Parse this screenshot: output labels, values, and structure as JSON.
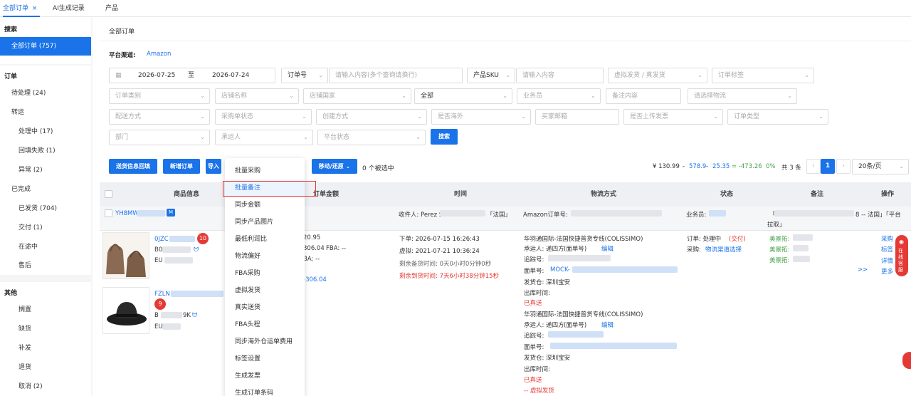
{
  "tabs": [
    {
      "label": "全部订单",
      "close": "×"
    },
    {
      "label": "AI生成记录"
    },
    {
      "label": "产品"
    }
  ],
  "sidebar": {
    "search_header": "搜索",
    "all_orders": "全部订单 (757)",
    "orders_header": "订单",
    "pending": "待处理 (24)",
    "transit": "转运",
    "processing": "处理中 (17)",
    "writeback_fail": "回填失败 (1)",
    "exception": "异常 (2)",
    "completed": "已完成",
    "shipped": "已发货 (704)",
    "delivered": "交付 (1)",
    "in_transit": "在途中",
    "after_sale": "售后",
    "other_header": "其他",
    "on_hold": "搁置",
    "out_of_stock": "缺货",
    "reissue": "补发",
    "returned": "退货",
    "cancelled": "取消 (2)"
  },
  "page": {
    "title": "全部订单",
    "channel_label": "平台渠道:",
    "channel_value": "Amazon"
  },
  "filters": {
    "date_start": "2026-07-25",
    "date_to": "至",
    "date_end": "2026-07-24",
    "order_no": "订单号",
    "search_placeholder": "请输入内容(多个查询请换行)",
    "product_sku": "产品SKU",
    "sku_placeholder": "请输入内容",
    "ship_type": "虚拟发货 / 真发货",
    "order_tag": "订单标签",
    "order_category": "订单类别",
    "store_name": "店铺名称",
    "store_country": "店铺国家",
    "all": "全部",
    "salesperson": "业务员",
    "remark": "备注内容",
    "logistics": "请选择物流",
    "delivery_method": "配送方式",
    "purchase_status": "采购单状态",
    "create_method": "创建方式",
    "overseas": "是否海外",
    "buyer_email": "买家邮箱",
    "invoice_uploaded": "是否上传发票",
    "order_type": "订单类型",
    "department": "部门",
    "carrier": "承运人",
    "platform_status": "平台状态",
    "search_btn": "搜索"
  },
  "toolbar": {
    "sync_ship": "送货信息回填",
    "new_order": "新增订单",
    "import": "导入",
    "move_restore": "移动/还原",
    "selected": "0 个被选中",
    "summary_total": "¥ 130.99",
    "summary_sep1": "-",
    "summary_a": "578.9",
    "summary_sep2": "-",
    "summary_b": "25.35",
    "summary_eq": "= -473.26",
    "summary_pct": "0%",
    "total_count": "共 3 条",
    "page": "1",
    "per_page": "20条/页"
  },
  "table": {
    "headers": [
      "商品信息",
      "订单金额",
      "时间",
      "物流方式",
      "状态",
      "备注",
      "操作"
    ],
    "order_id": "YH8MW",
    "receiver": "收件人: Perez S",
    "receiver_country": "「法国」",
    "amazon_no": "Amazon订单号:",
    "salesperson": "业务员:",
    "remark_top": "8 -- 法国」「平台",
    "remark_top2": "拉取」",
    "item1_sku": "0JZC",
    "item1_line2": "B0",
    "item1_line3": "EU",
    "badge1": "10",
    "item2_sku": "FZLN",
    "item2_line2": "B",
    "item2_line2b": "9K",
    "item2_line3": "EU",
    "badge2": "9",
    "amount1": "20.95",
    "amount2": "306.04",
    "fba": "FBA: --",
    "amount3": "BA: --",
    "amount_link": "-306.04",
    "order_time": "下单: 2026-07-15 16:26:43",
    "virtual_time": "虚拟: 2021-07-21 10:36:24",
    "remain_prep": "剩余备货时间: 0天0小时0分钟0秒",
    "remain_ship": "剩余到货时间: 7天6小时38分钟15秒",
    "lg1_title": "华羽通国际-法国快捷普货专线(COLISSIMO)",
    "lg_carrier": "承运人: 递四方",
    "lg_face": "(面单号)",
    "lg_edit": "编辑",
    "lg_track": "追踪号:",
    "lg_facesheet": "面单号:",
    "lg_mock": "MOCK-",
    "lg_origin": "发货仓: 深圳宝安",
    "lg_outtime": "出库时间:",
    "lg_shipped": "已真送",
    "lg2_origin": "发货仓: 深圳宝安",
    "lg2_virtual": "-- 虚拟发货",
    "st_process": "订单: 处理中",
    "st_delivered": "(交付)",
    "st_purchase": "采购:",
    "st_link": "物流渠道选择",
    "rm1": "美景拓:",
    "rm2": "美景拓:",
    "rm3": "美景拓:",
    "rm_more": ">>",
    "op1": "采购",
    "op2": "标签",
    "op3": "详情",
    "op4": "更多"
  },
  "dropdown": [
    "批量采购",
    "批量备注",
    "同步金额",
    "同步产品图片",
    "最低利润比",
    "物流偏好",
    "FBA采购",
    "虚拟发货",
    "真实送货",
    "FBA头程",
    "同步海外仓运单费用",
    "标签设置",
    "生成发票",
    "生成订单条码"
  ],
  "chat": {
    "label": "在线客服"
  }
}
